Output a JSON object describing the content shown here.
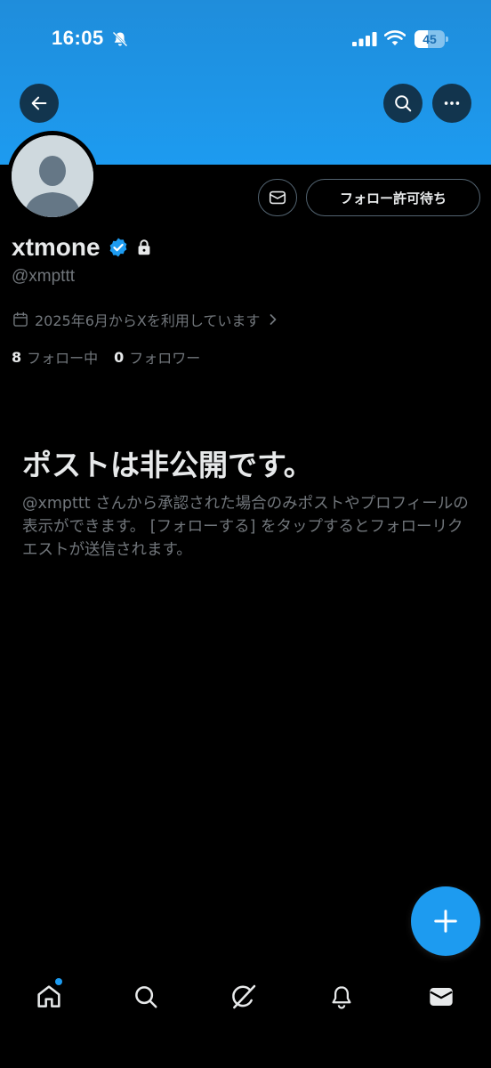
{
  "status_bar": {
    "time": "16:05",
    "battery_level": "45",
    "battery_fraction": 0.45,
    "icons": [
      "bell-slash-icon",
      "cellular-signal-icon",
      "wifi-icon",
      "battery-icon"
    ]
  },
  "colors": {
    "accent": "#1d9bf0",
    "banner": "#1d9bf0",
    "background": "#000000",
    "primary_text": "#e7e9ea",
    "secondary_text": "#71767b",
    "border": "#536471"
  },
  "header": {
    "back_icon": "arrow-left-icon",
    "search_icon": "search-icon",
    "more_icon": "more-horizontal-icon"
  },
  "profile": {
    "name": "xtmone",
    "handle": "@xmpttt",
    "joined": "2025年6月からXを利用しています",
    "following_count": "8",
    "following_label": "フォロー中",
    "followers_count": "0",
    "followers_label": "フォロワー",
    "verified_icon": "verified-badge-icon",
    "lock_icon": "lock-icon"
  },
  "actions": {
    "message_icon": "envelope-icon",
    "follow_button": "フォロー許可待ち"
  },
  "private_notice": {
    "title": "ポストは非公開です。",
    "description": "@xmpttt さんから承認された場合のみポストやプロフィールの表示ができます。 [フォローする] をタップするとフォローリクエストが送信されます。"
  },
  "fab": {
    "icon": "plus-icon"
  },
  "bottom_nav": {
    "items": [
      "home-icon",
      "search-icon",
      "grok-icon",
      "bell-icon",
      "envelope-icon"
    ]
  }
}
